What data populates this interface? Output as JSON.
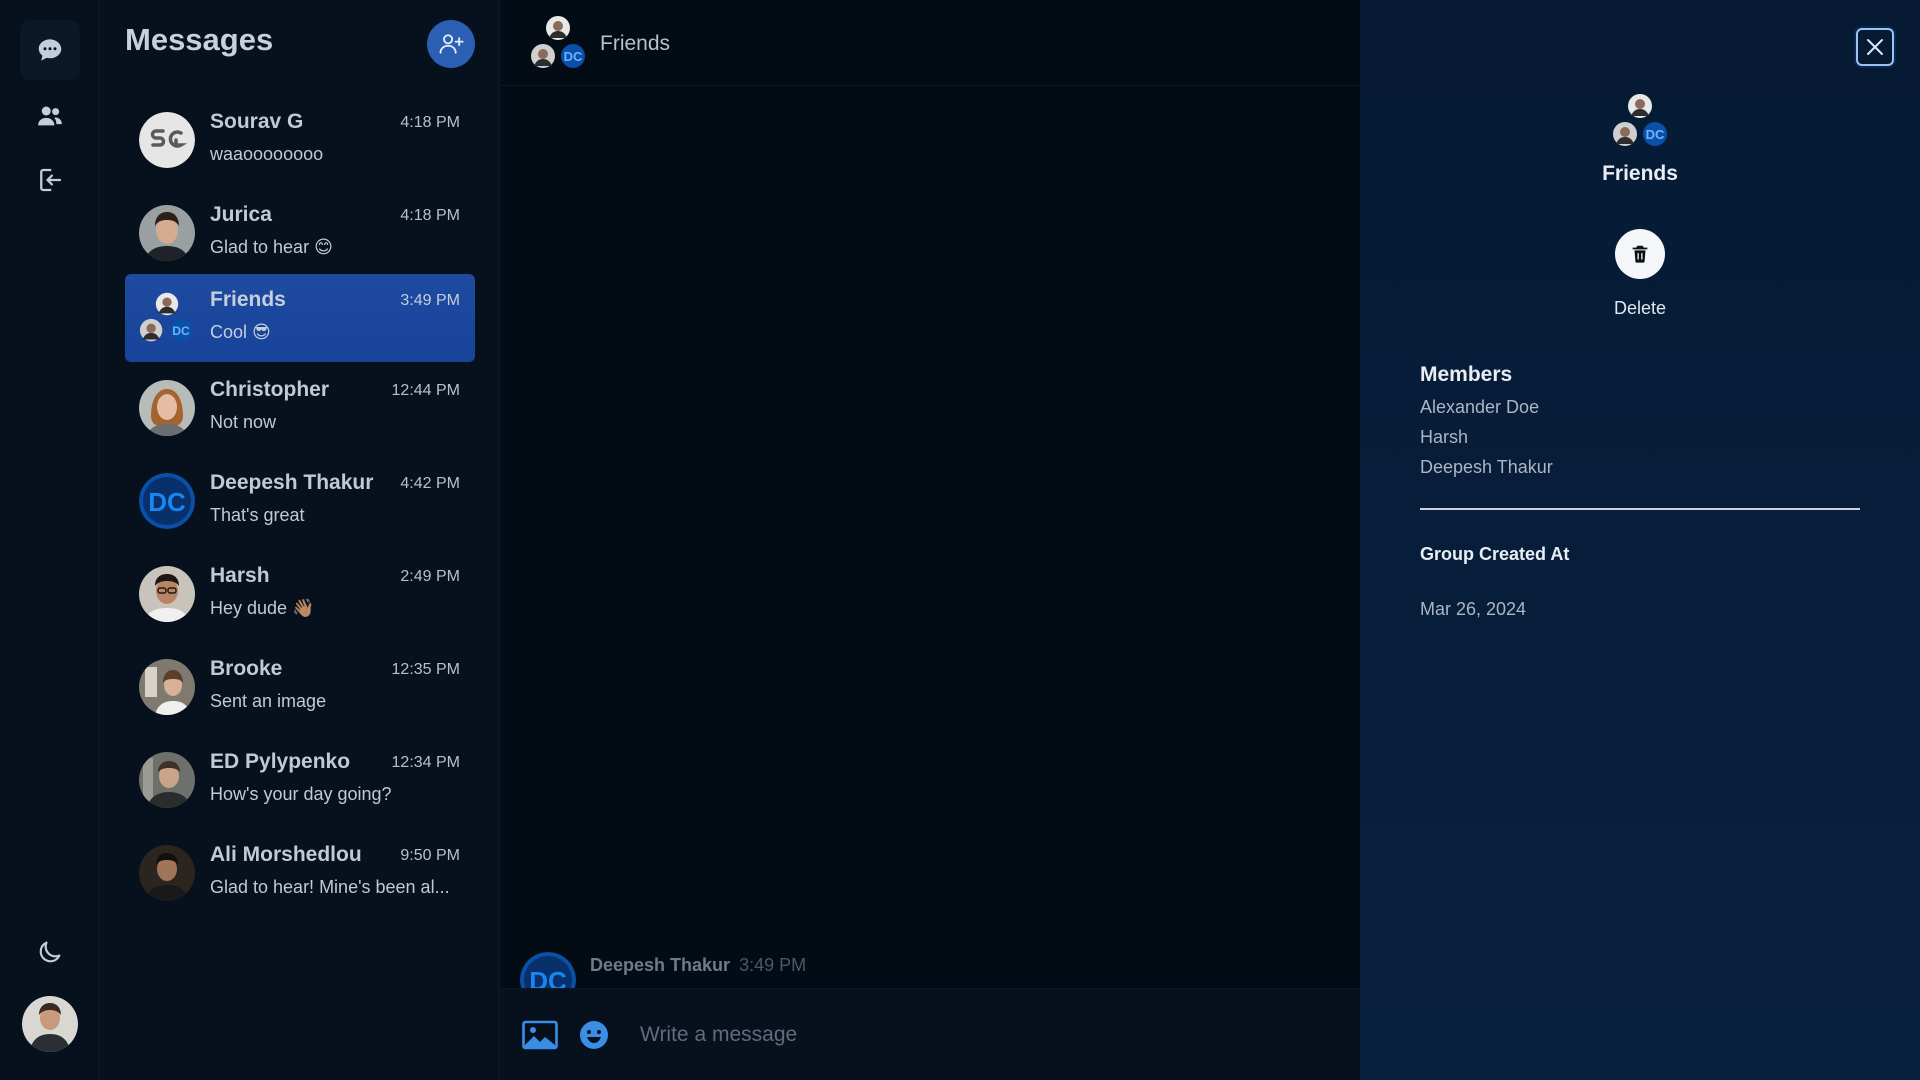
{
  "rail": {
    "items": [
      {
        "icon": "chat-bubble-icon",
        "active": true
      },
      {
        "icon": "users-icon",
        "active": false
      },
      {
        "icon": "logout-icon",
        "active": false
      }
    ],
    "theme_icon": "moon-icon"
  },
  "list": {
    "title": "Messages",
    "new_group_icon": "add-user-icon",
    "conversations": [
      {
        "name": "Sourav G",
        "time": "4:18 PM",
        "preview": "waaoooooooo",
        "avatar": "initials"
      },
      {
        "name": "Jurica",
        "time": "4:18 PM",
        "preview": "Glad to hear 😊",
        "avatar": "photo"
      },
      {
        "name": "Friends",
        "time": "3:49 PM",
        "preview": "Cool 😎",
        "avatar": "group",
        "active": true
      },
      {
        "name": "Christopher",
        "time": "12:44 PM",
        "preview": "Not now",
        "avatar": "photo"
      },
      {
        "name": "Deepesh Thakur",
        "time": "4:42 PM",
        "preview": "That's great",
        "avatar": "dc-logo"
      },
      {
        "name": "Harsh",
        "time": "2:49 PM",
        "preview": "Hey dude 👋🏽",
        "avatar": "photo"
      },
      {
        "name": "Brooke",
        "time": "12:35 PM",
        "preview": "Sent an image",
        "avatar": "photo"
      },
      {
        "name": "ED Pylypenko",
        "time": "12:34 PM",
        "preview": "How's your day going?",
        "avatar": "photo"
      },
      {
        "name": "Ali Morshedlou",
        "time": "9:50 PM",
        "preview": "Glad to hear! Mine's been al...",
        "avatar": "photo"
      }
    ]
  },
  "chat": {
    "title": "Friends",
    "last_message": {
      "sender": "Deepesh Thakur",
      "time": "3:49 PM"
    },
    "composer": {
      "placeholder": "Write a message",
      "value": ""
    }
  },
  "panel": {
    "title": "Friends",
    "delete_label": "Delete",
    "members_title": "Members",
    "members": [
      "Alexander Doe",
      "Harsh",
      "Deepesh Thakur"
    ],
    "created_title": "Group Created At",
    "created_value": "Mar 26, 2024"
  },
  "colors": {
    "accent": "#2b5fb4",
    "active_row": "#1e4aa0",
    "panel_bg": "#061a33",
    "dc_blue": "#0a6bd6"
  }
}
